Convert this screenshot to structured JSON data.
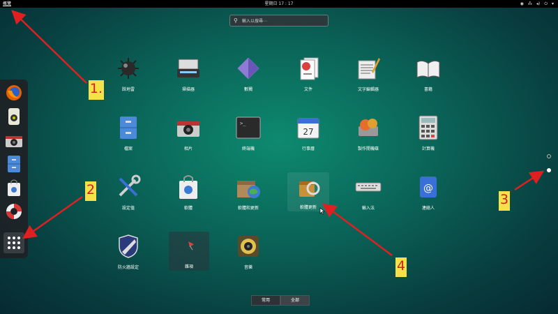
{
  "topbar": {
    "activities_label": "概覽",
    "clock": "星期日 17 : 17"
  },
  "search": {
    "placeholder": "輸入以搜尋⋯"
  },
  "apps": [
    {
      "label": "踩地雷"
    },
    {
      "label": "掃描器"
    },
    {
      "label": "數獨"
    },
    {
      "label": "文件"
    },
    {
      "label": "文字編輯器"
    },
    {
      "label": "書籍"
    },
    {
      "label": "檔案"
    },
    {
      "label": "相片"
    },
    {
      "label": "終端機"
    },
    {
      "label": "行事曆",
      "day": "27"
    },
    {
      "label": "製作開機碟"
    },
    {
      "label": "計算機"
    },
    {
      "label": "設定值"
    },
    {
      "label": "軟體"
    },
    {
      "label": "軟體和更新"
    },
    {
      "label": "軟體更新"
    },
    {
      "label": "輸入法"
    },
    {
      "label": "連絡人"
    },
    {
      "label": "防火牆設定"
    },
    {
      "label": "雜項"
    },
    {
      "label": "音樂"
    }
  ],
  "bottom_tabs": [
    "常用",
    "全部"
  ],
  "annotations": [
    "1.",
    "2",
    "3",
    "4"
  ],
  "colors": {
    "annotation_arrow": "#e02020",
    "annotation_bg": "#f5e24a"
  }
}
